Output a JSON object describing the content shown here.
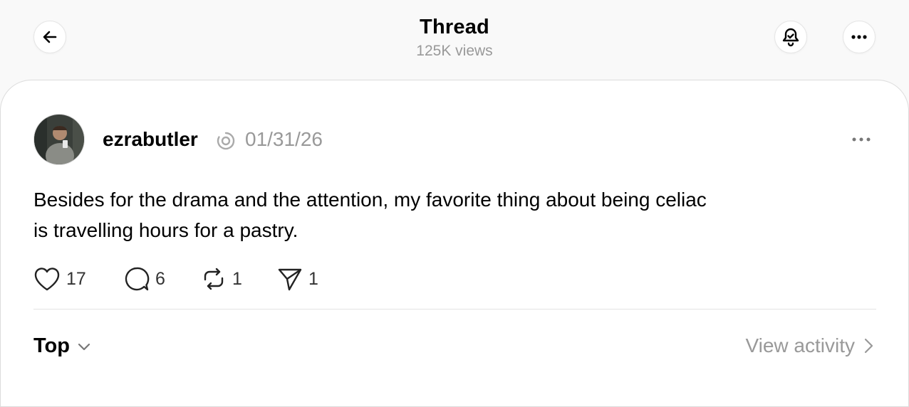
{
  "header": {
    "title": "Thread",
    "subtitle": "125K views",
    "back_icon": "arrow-left-icon",
    "bell_icon": "bell-check-icon",
    "more_icon": "more-horizontal-icon"
  },
  "post": {
    "username": "ezrabutler",
    "date": "01/31/26",
    "text_lines": [
      "Besides for the drama and the attention, my favorite thing about being celiac",
      "is travelling hours for a pastry."
    ],
    "actions": {
      "likes": "17",
      "replies": "6",
      "reposts": "1",
      "shares": "1"
    }
  },
  "footer": {
    "sort_label": "Top",
    "view_activity_label": "View activity"
  },
  "colors": {
    "background": "#f9f9f9",
    "card": "#ffffff",
    "muted_text": "#999999",
    "primary_text": "#000000"
  }
}
